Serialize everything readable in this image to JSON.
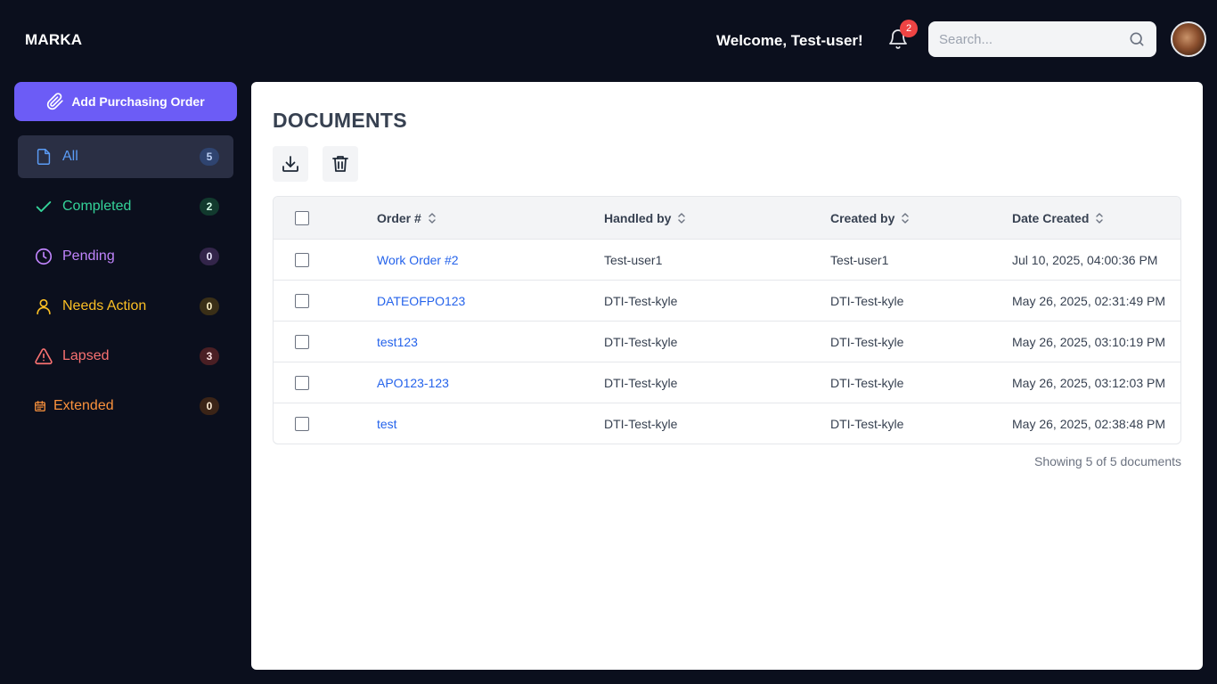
{
  "header": {
    "brand": "MARKA",
    "welcome": "Welcome, Test-user!",
    "notification_count": "2",
    "search_placeholder": "Search..."
  },
  "sidebar": {
    "add_button_label": "Add Purchasing Order",
    "items": [
      {
        "label": "All",
        "count": "5",
        "color": "#5b9cf6",
        "icon": "file-icon",
        "active": true
      },
      {
        "label": "Completed",
        "count": "2",
        "color": "#34d399",
        "icon": "check-icon"
      },
      {
        "label": "Pending",
        "count": "0",
        "color": "#c084fc",
        "icon": "clock-icon"
      },
      {
        "label": "Needs Action",
        "count": "0",
        "color": "#fbbf24",
        "icon": "user-icon"
      },
      {
        "label": "Lapsed",
        "count": "3",
        "color": "#f87171",
        "icon": "warning-icon"
      },
      {
        "label": "Extended",
        "count": "0",
        "color": "#fb923c",
        "icon": "calendar-icon"
      }
    ]
  },
  "main": {
    "title": "DOCUMENTS",
    "columns": {
      "order": "Order #",
      "handled_by": "Handled by",
      "created_by": "Created by",
      "date_created": "Date Created"
    },
    "rows": [
      {
        "order": "Work Order #2",
        "handled_by": "Test-user1",
        "created_by": "Test-user1",
        "date_created": "Jul 10, 2025, 04:00:36 PM"
      },
      {
        "order": "DATEOFPO123",
        "handled_by": "DTI-Test-kyle",
        "created_by": "DTI-Test-kyle",
        "date_created": "May 26, 2025, 02:31:49 PM"
      },
      {
        "order": "test123",
        "handled_by": "DTI-Test-kyle",
        "created_by": "DTI-Test-kyle",
        "date_created": "May 26, 2025, 03:10:19 PM"
      },
      {
        "order": "APO123-123",
        "handled_by": "DTI-Test-kyle",
        "created_by": "DTI-Test-kyle",
        "date_created": "May 26, 2025, 03:12:03 PM"
      },
      {
        "order": "test",
        "handled_by": "DTI-Test-kyle",
        "created_by": "DTI-Test-kyle",
        "date_created": "May 26, 2025, 02:38:48 PM"
      }
    ],
    "footer": "Showing 5 of 5 documents"
  },
  "colors": {
    "background": "#0b0f1d",
    "accent": "#6c5cf6",
    "link": "#2563eb",
    "badge": "#ef4444"
  }
}
